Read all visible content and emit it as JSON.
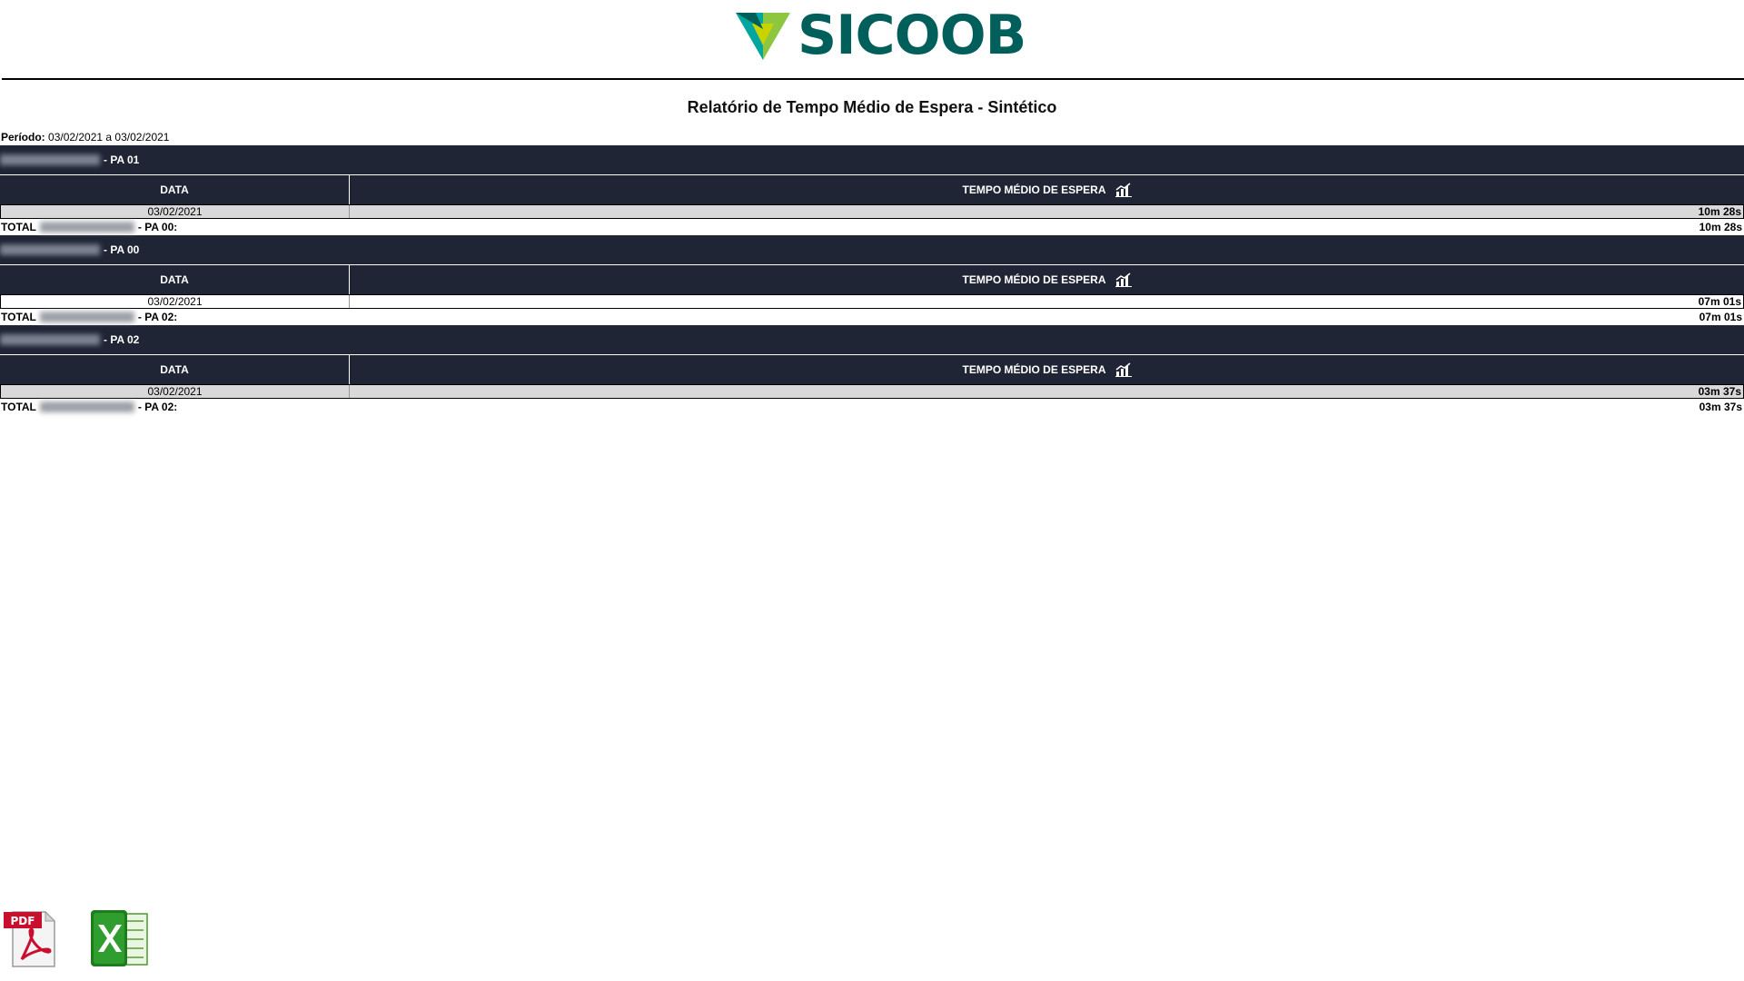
{
  "brand": {
    "name": "SICOOB",
    "logo_color": "#005f5b",
    "logo_accent": "#8dc63f",
    "logo_accent2": "#c9d300"
  },
  "report": {
    "title": "Relatório de Tempo Médio de Espera - Sintético",
    "periodo_label": "Período:",
    "periodo_value": "03/02/2021 a 03/02/2021",
    "header_color": "#1f2535",
    "col_data": "DATA",
    "col_tempo": "TEMPO MÉDIO DE ESPERA",
    "total_label": "TOTAL",
    "groups": [
      {
        "name_suffix": "- PA 01",
        "date": "03/02/2021",
        "value": "10m 28s",
        "total_suffix": "- PA 00:",
        "total_value": "10m 28s"
      },
      {
        "name_suffix": "- PA 00",
        "date": "03/02/2021",
        "value": "07m 01s",
        "total_suffix": "- PA 02:",
        "total_value": "07m 01s"
      },
      {
        "name_suffix": "- PA 02",
        "date": "03/02/2021",
        "value": "03m 37s",
        "total_suffix": "- PA 02:",
        "total_value": "03m 37s"
      }
    ]
  },
  "exports": {
    "pdf_label": "PDF",
    "pdf_icon": "pdf-icon",
    "xls_icon": "excel-icon"
  }
}
